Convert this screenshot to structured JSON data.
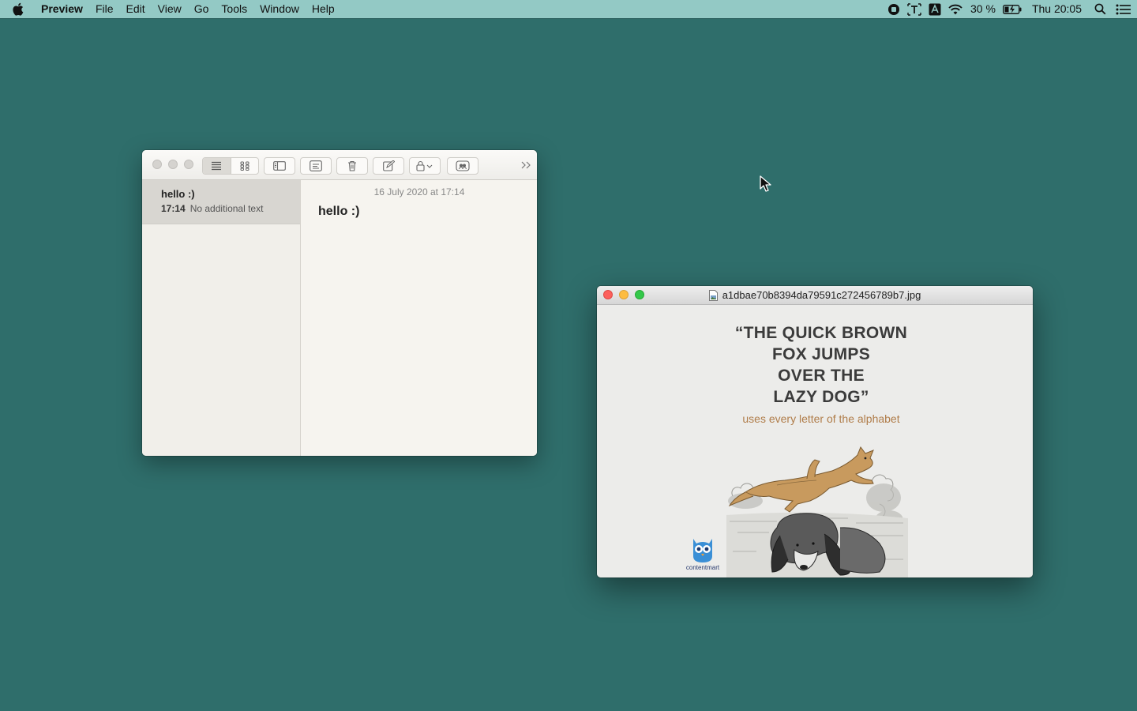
{
  "menubar": {
    "app_name": "Preview",
    "menus": [
      "File",
      "Edit",
      "View",
      "Go",
      "Tools",
      "Window",
      "Help"
    ],
    "status_icons": [
      "screen-record-icon",
      "text-input-icon",
      "adobe-icon",
      "wifi-icon"
    ],
    "battery_percent": "30 %",
    "clock": "Thu 20:05",
    "trailing_icons": [
      "spotlight-search-icon",
      "notification-center-icon"
    ]
  },
  "notes_window": {
    "toolbar_icons": [
      "list-view-icon",
      "gallery-view-icon",
      "sidebar-icon",
      "attachments-icon",
      "delete-icon",
      "compose-icon",
      "lock-icon",
      "share-icon",
      "more-chevron-icon"
    ],
    "note_list": [
      {
        "title": "hello :)",
        "time": "17:14",
        "preview": "No additional text"
      }
    ],
    "editor": {
      "date": "16 July 2020 at 17:14",
      "body": "hello :)"
    }
  },
  "preview_window": {
    "filename": "a1dbae70b8394da79591c272456789b7.jpg",
    "image": {
      "headline_lines": [
        "“THE QUICK BROWN",
        "FOX JUMPS",
        "OVER THE",
        "LAZY DOG”"
      ],
      "subline": "uses every letter of the alphabet",
      "logo_text": "contentmart"
    }
  },
  "colors": {
    "desktop": "#2f6e6b",
    "menubar": "#93c9c5",
    "close": "#fc605c",
    "minimize": "#fdbc40",
    "zoom": "#34c84a",
    "subline": "#b07d4a"
  }
}
